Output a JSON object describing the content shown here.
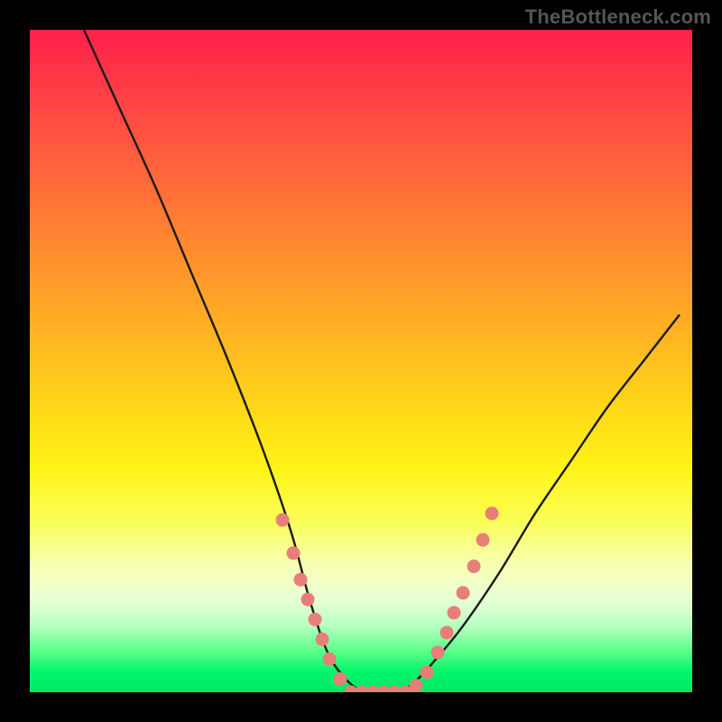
{
  "watermark": "TheBottleneck.com",
  "colors": {
    "frame": "#000000",
    "marker_fill": "#e77f78",
    "curve_stroke": "#1a1a1a"
  },
  "chart_data": {
    "type": "line",
    "title": "",
    "xlabel": "",
    "ylabel": "",
    "xlim": [
      0,
      734
    ],
    "ylim": [
      0,
      100
    ],
    "note": "No axes or tick labels are visible. The curve is a V-shaped line descending from top-left to a flat bottom around x≈340–420 (y≈0) and rising toward the right. Y values below are approximate bottleneck percentage (100=top of plot, 0=bottom).",
    "series": [
      {
        "name": "bottleneck-curve",
        "x": [
          60,
          100,
          140,
          180,
          220,
          260,
          290,
          310,
          330,
          350,
          370,
          390,
          410,
          430,
          450,
          480,
          520,
          560,
          600,
          640,
          680,
          720
        ],
        "values": [
          100,
          88,
          76,
          63,
          50,
          36,
          24,
          14,
          6,
          2,
          0,
          0,
          0,
          2,
          5,
          10,
          18,
          27,
          35,
          43,
          50,
          57
        ]
      }
    ],
    "markers": {
      "name": "highlighted-points",
      "note": "Salmon dots clustered along the lower part of both curve walls and across the flat bottom.",
      "x": [
        280,
        292,
        300,
        308,
        316,
        324,
        332,
        344,
        356,
        368,
        380,
        392,
        404,
        416,
        428,
        440,
        452,
        462,
        470,
        480,
        492,
        502,
        512
      ],
      "values": [
        26,
        21,
        17,
        14,
        11,
        8,
        5,
        2,
        0,
        0,
        0,
        0,
        0,
        0,
        1,
        3,
        6,
        9,
        12,
        15,
        19,
        23,
        27
      ]
    }
  }
}
